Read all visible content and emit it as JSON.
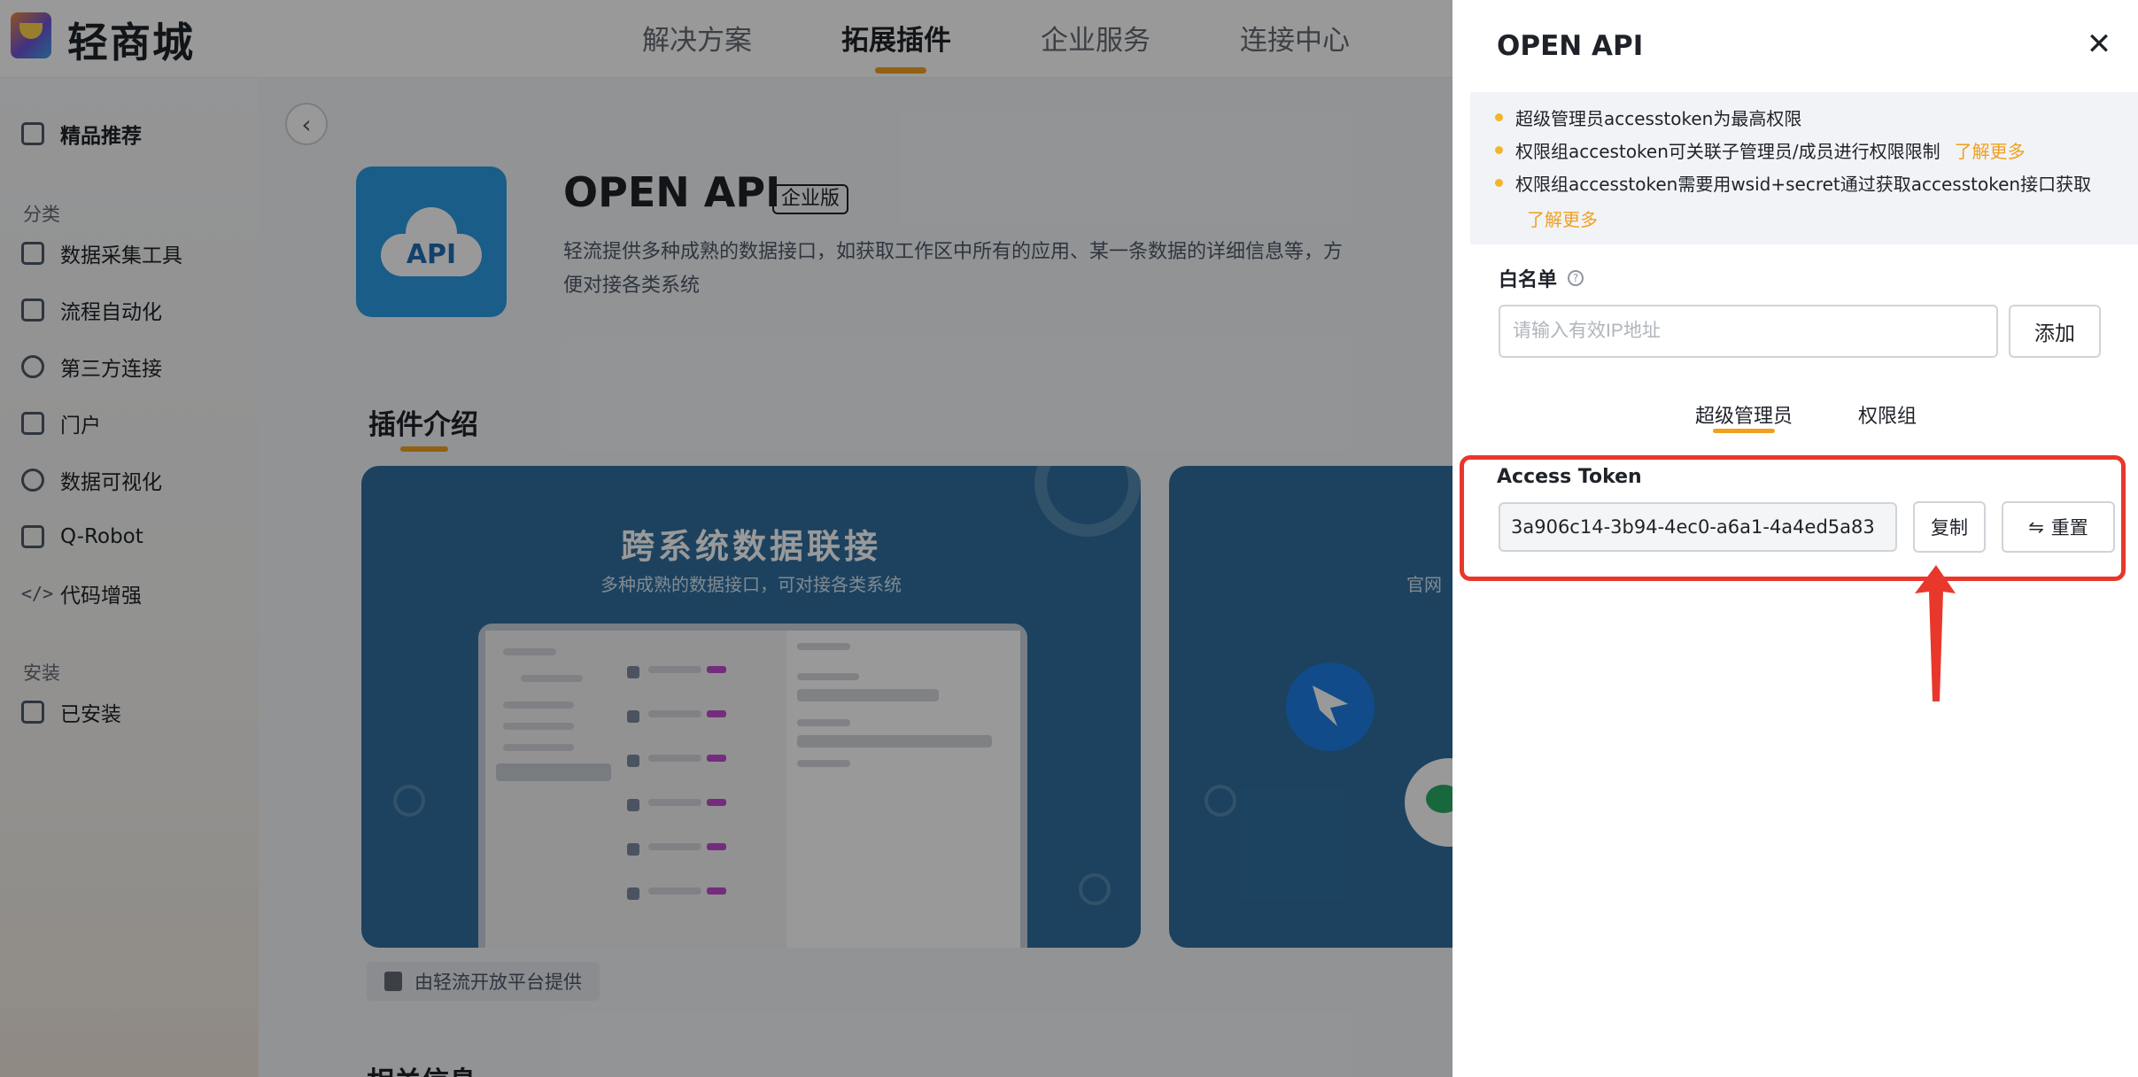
{
  "app": {
    "logo_text": "轻商城"
  },
  "topnav": {
    "items": [
      "解决方案",
      "拓展插件",
      "企业服务",
      "连接中心"
    ],
    "active_index": 1
  },
  "sidebar": {
    "featured": "精品推荐",
    "category_heading": "分类",
    "categories": [
      "数据采集工具",
      "流程自动化",
      "第三方连接",
      "门户",
      "数据可视化",
      "Q-Robot",
      "代码增强"
    ],
    "installed_heading": "安装",
    "installed": "已安装"
  },
  "plugin": {
    "icon_text": "API",
    "title": "OPEN API",
    "badge": "企业版",
    "description": "轻流提供多种成熟的数据接口，如获取工作区中所有的应用、某一条数据的详细信息等，方便对接各类系统"
  },
  "intro": {
    "section_title": "插件介绍",
    "card1_title": "跨系统数据联接",
    "card1_subtitle": "多种成熟的数据接口，可对接各类系统",
    "card2_subtitle": "官网",
    "provider": "由轻流开放平台提供",
    "related_title": "相关信息"
  },
  "drawer": {
    "title": "OPEN API",
    "close_icon": "close-icon",
    "notices": [
      {
        "text": "超级管理员accesstoken为最高权限",
        "link": ""
      },
      {
        "text": "权限组accestoken可关联子管理员/成员进行权限限制",
        "link": "了解更多"
      },
      {
        "text": "权限组accesstoken需要用wsid+secret通过获取accesstoken接口获取",
        "link": ""
      }
    ],
    "notice_more": "了解更多",
    "whitelist_label": "白名单",
    "ip_placeholder": "请输入有效IP地址",
    "add_label": "添加",
    "tabs": [
      "超级管理员",
      "权限组"
    ],
    "active_tab": 0,
    "token_label": "Access Token",
    "token_value": "3a906c14-3b94-4ec0-a6a1-4a4ed5a83",
    "copy_label": "复制",
    "reset_label": "重置"
  },
  "colors": {
    "accent": "#f0a020",
    "highlight": "#e8372b",
    "dim_overlay": "rgba(0,0,0,0.40)"
  }
}
